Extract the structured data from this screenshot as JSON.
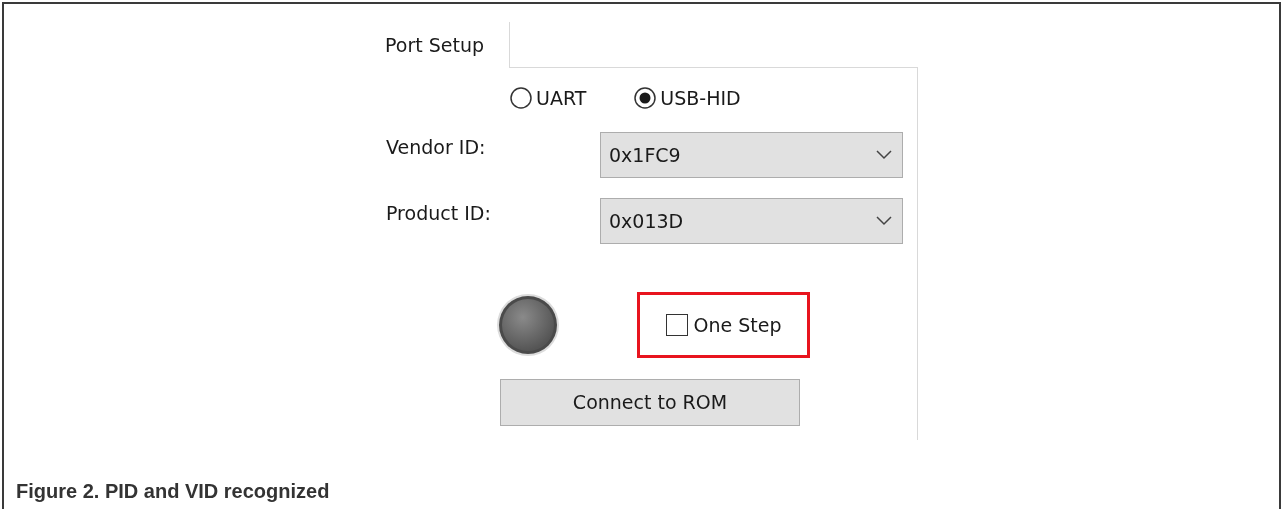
{
  "tabs": [
    {
      "label": "Port Setup",
      "selected": true
    }
  ],
  "interface_options": [
    {
      "label": "UART",
      "selected": false
    },
    {
      "label": "USB-HID",
      "selected": true
    }
  ],
  "fields": [
    {
      "label": "Vendor ID:",
      "value": "0x1FC9"
    },
    {
      "label": "Product ID:",
      "value": "0x013D"
    }
  ],
  "status_led": {
    "on": false
  },
  "one_step": {
    "label": "One Step",
    "checked": false,
    "highlighted": true
  },
  "connect_button": "Connect to ROM",
  "caption": "Figure 2.  PID and VID recognized"
}
